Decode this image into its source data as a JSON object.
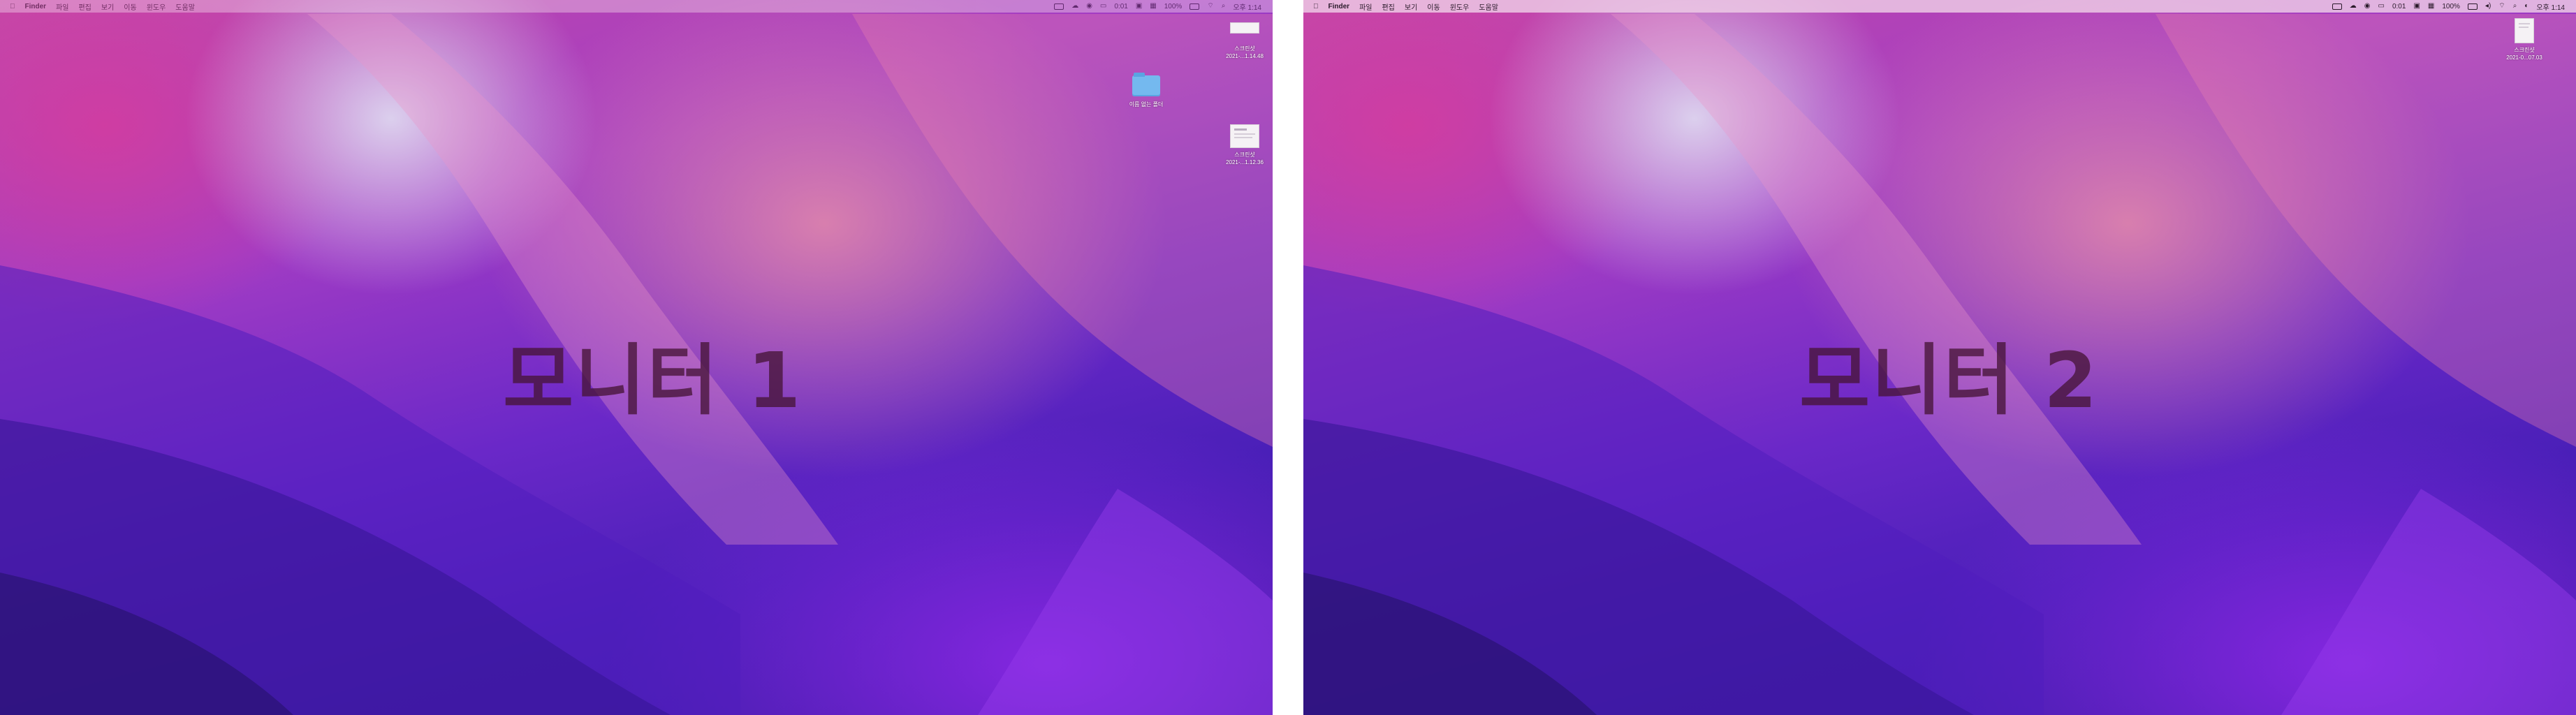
{
  "monitors": [
    {
      "label": "모니터 1",
      "menubar": {
        "app_name": "Finder",
        "menus": [
          "파일",
          "편집",
          "보기",
          "이동",
          "윈도우",
          "도움말"
        ],
        "status": {
          "time_indicator": "0:01",
          "battery_percent": "100%",
          "clock": "오후 1:14",
          "icons": [
            "display-icon",
            "cloud-icon",
            "record-icon",
            "screen-icon",
            "box-icon",
            "grid-icon",
            "wifi-icon",
            "search-icon"
          ]
        }
      },
      "desktop_items": [
        {
          "name": "스크린샷",
          "date": "2021-...1.14.48",
          "kind": "screenshot-wide"
        },
        {
          "name": "이름 없는 폴더",
          "kind": "folder"
        },
        {
          "name": "스크린샷",
          "date": "2021-...1.12.36",
          "kind": "screenshot"
        }
      ]
    },
    {
      "label": "모니터 2",
      "menubar": {
        "app_name": "Finder",
        "menus": [
          "파일",
          "편집",
          "보기",
          "이동",
          "윈도우",
          "도움말"
        ],
        "status": {
          "time_indicator": "0:01",
          "battery_percent": "100%",
          "clock": "오후 1:14",
          "icons": [
            "display-icon",
            "cloud-icon",
            "record-icon",
            "screen-icon",
            "box-icon",
            "grid-icon",
            "volume-icon",
            "wifi-icon",
            "search-icon",
            "control-center-icon"
          ]
        }
      },
      "desktop_items": [
        {
          "name": "스크린샷",
          "date": "2021-0...07.03",
          "kind": "document"
        }
      ]
    }
  ]
}
